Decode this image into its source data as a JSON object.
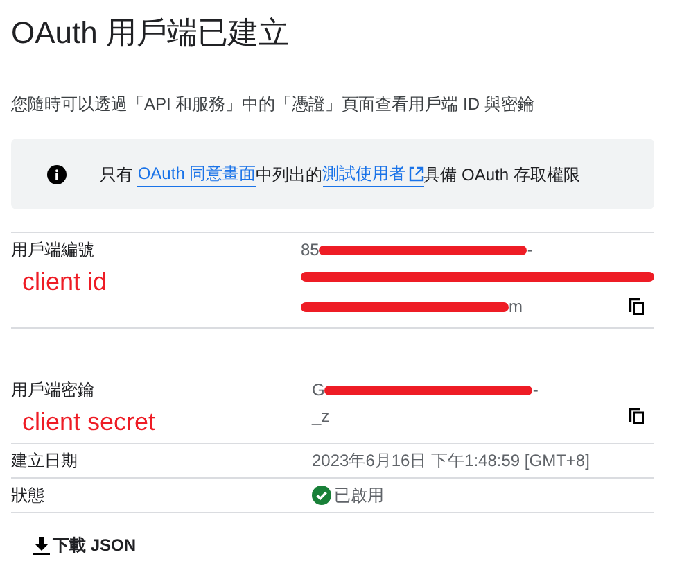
{
  "title": "OAuth 用戶端已建立",
  "description": "您隨時可以透過「API 和服務」中的「憑證」頁面查看用戶端 ID 與密鑰",
  "notice": {
    "parts": [
      {
        "kind": "text",
        "text": "只有 "
      },
      {
        "kind": "link",
        "text": "OAuth 同意畫面",
        "external": false
      },
      {
        "kind": "text",
        "text": "中列出的"
      },
      {
        "kind": "link",
        "text": "測試使用者",
        "external": true
      },
      {
        "kind": "text",
        "text": "具備 OAuth 存取權限"
      }
    ]
  },
  "fields": [
    {
      "label": "用戶端編號",
      "annotation": "client id",
      "copyable": true,
      "lines": [
        [
          {
            "kind": "text",
            "text": "85"
          },
          {
            "kind": "redacted"
          },
          {
            "kind": "text",
            "text": "-"
          }
        ],
        [
          {
            "kind": "redacted"
          }
        ],
        [
          {
            "kind": "redacted"
          },
          {
            "kind": "text",
            "text": "m"
          }
        ]
      ]
    },
    {
      "label": "用戶端密鑰",
      "annotation": "client secret",
      "copyable": true,
      "lines": [
        [
          {
            "kind": "text",
            "text": "G"
          },
          {
            "kind": "redacted"
          },
          {
            "kind": "text",
            "text": "-"
          }
        ],
        [
          {
            "kind": "text",
            "text": "_z"
          }
        ]
      ]
    },
    {
      "label": "建立日期",
      "copyable": false,
      "lines": [
        [
          {
            "kind": "text",
            "text": "2023年6月16日 下午1:48:59 [GMT+8]"
          }
        ]
      ]
    },
    {
      "label": "狀態",
      "copyable": false,
      "lines": [
        [
          {
            "kind": "status",
            "text": "已啟用"
          }
        ]
      ]
    }
  ],
  "download_button": "下載 JSON"
}
